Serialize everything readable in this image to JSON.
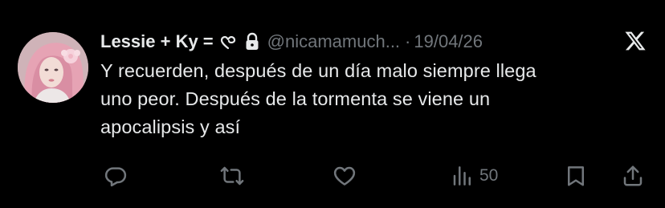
{
  "tweet": {
    "display_name": "Lessie + Ky =",
    "name_glyph_icon": "loop-heart-icon",
    "protected_icon": "lock-icon",
    "handle": "@nicamamuch...",
    "separator": "·",
    "date": "19/04/26",
    "platform_logo": "x-logo-icon",
    "text_lines": [
      "Y recuerden, después de un día malo siempre llega",
      "uno peor. Después de la tormenta se viene un",
      "apocalipsis y así"
    ]
  },
  "actions": {
    "reply_icon": "reply-icon",
    "retweet_icon": "retweet-icon",
    "like_icon": "heart-icon",
    "views_icon": "views-bar-icon",
    "views_count": "50",
    "bookmark_icon": "bookmark-icon",
    "share_icon": "share-icon"
  },
  "colors": {
    "background": "#000000",
    "primary_text": "#e7e9ea",
    "secondary_text": "#71767b"
  }
}
